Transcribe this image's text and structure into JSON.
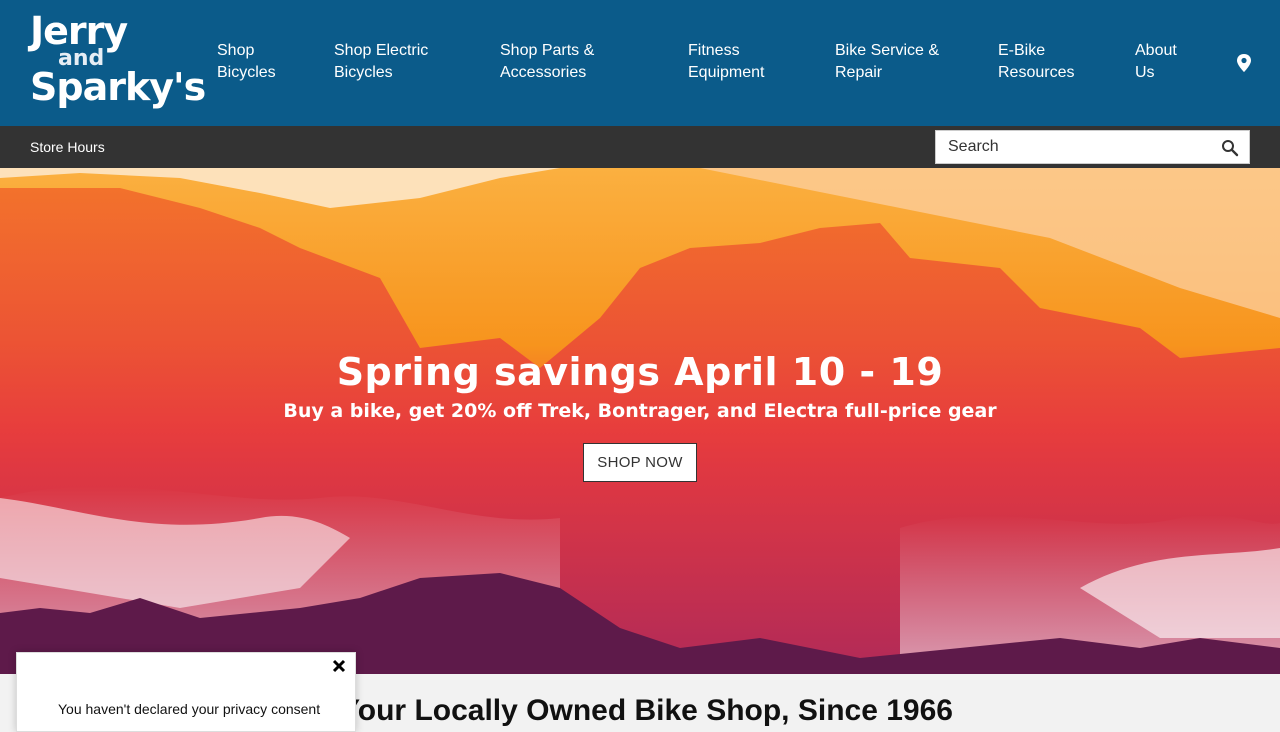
{
  "brand": {
    "logo_line1": "Jerry",
    "logo_line2": "and",
    "logo_line3": "Sparky's"
  },
  "nav": {
    "items": [
      {
        "line1": "Shop",
        "line2": "Bicycles"
      },
      {
        "line1": "Shop Electric",
        "line2": "Bicycles"
      },
      {
        "line1": "Shop Parts &",
        "line2": "Accessories"
      },
      {
        "line1": "Fitness",
        "line2": "Equipment"
      },
      {
        "line1": "Bike Service &",
        "line2": "Repair"
      },
      {
        "line1": "E-Bike",
        "line2": "Resources"
      },
      {
        "line1": "About",
        "line2": "Us"
      }
    ],
    "location_icon": "map-pin-icon"
  },
  "subbar": {
    "store_hours": "Store Hours",
    "search_placeholder": "Search",
    "search_icon": "search-icon"
  },
  "hero": {
    "title": "Spring savings April 10 - 19",
    "subtitle": "Buy a bike, get 20% off Trek, Bontrager, and Electra full-price gear",
    "cta": "SHOP NOW"
  },
  "main": {
    "tagline": "Your Locally Owned Bike Shop, Since 1966"
  },
  "consent": {
    "text": "You haven't declared your privacy consent",
    "close_icon": "close-icon"
  },
  "colors": {
    "header_bg": "#0b5b8a",
    "subbar_bg": "#333333",
    "hero_orange": "#f7941d",
    "hero_red": "#ef3b3b",
    "hero_purple": "#6b1f4f"
  }
}
